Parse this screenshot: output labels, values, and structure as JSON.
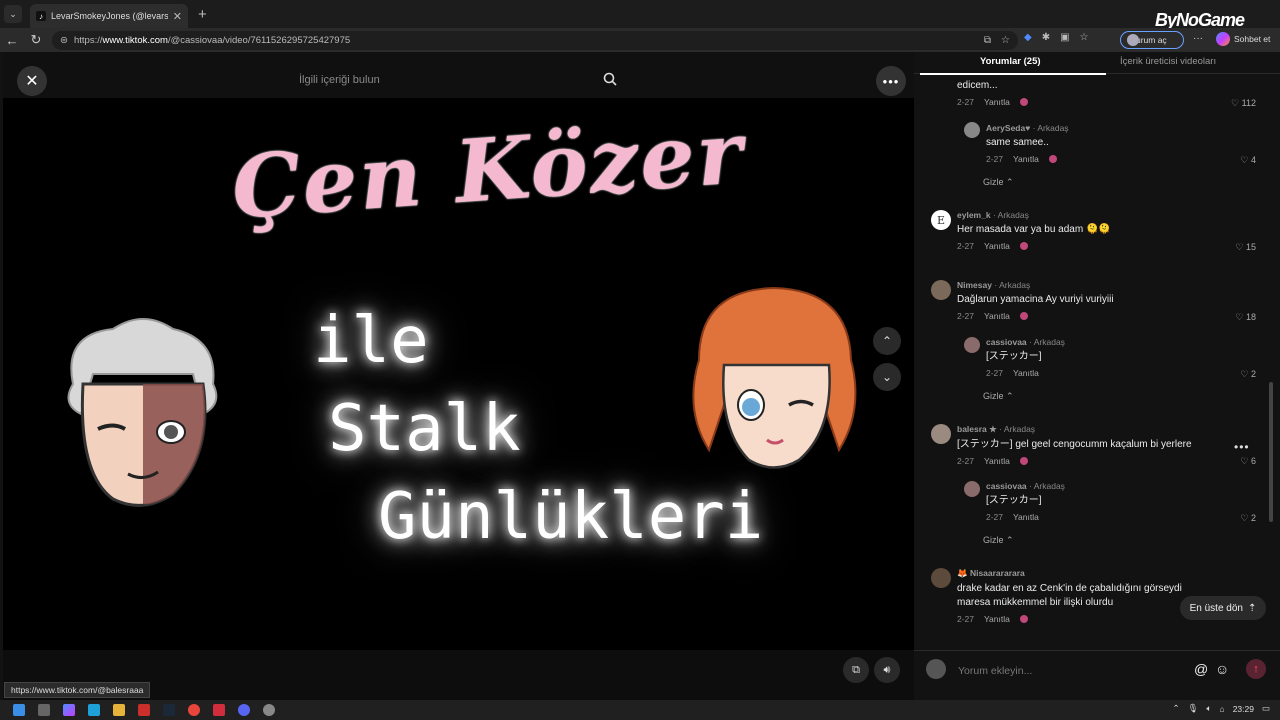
{
  "browser": {
    "tab_title": "LevarSmokeyJones (@levarsmokeyjo",
    "url_prefix": "https://",
    "url_host": "www.tiktok.com",
    "url_path": "/@cassiovaa/video/7611526295725427975",
    "signin_label": "Oturum aç",
    "chat_label": "Sohbet et",
    "watermark": "ByNoGame"
  },
  "video": {
    "search_placeholder": "İlgili içeriği bulun",
    "title_line": "Çen Közer",
    "glow_lines": [
      "ile",
      "Stalk",
      "Günlükleri"
    ]
  },
  "panel": {
    "tab_comments": "Yorumlar (25)",
    "tab_creator": "İçerik üreticisi videoları",
    "back_to_top": "En üste dön",
    "input_placeholder": "Yorum ekleyin...",
    "reply_label": "Yanıtla",
    "hide_label": "Gizle",
    "comments": [
      {
        "text": "edicem...",
        "date": "2-27",
        "likes": "112"
      },
      {
        "user": "AerySeda♥",
        "rel": "· Arkadaş",
        "text": "same samee..",
        "date": "2-27",
        "likes": "4"
      },
      {
        "user": "eylem_k",
        "rel": "· Arkadaş",
        "text": "Her masada var ya bu adam 🫠🫠",
        "date": "2-27",
        "likes": "15"
      },
      {
        "user": "Nimesay",
        "rel": "· Arkadaş",
        "text": "Dağlarun yamacina Ay vuriyi vuriyiii",
        "date": "2-27",
        "likes": "18"
      },
      {
        "user": "cassiovaa",
        "rel": "· Arkadaş",
        "text": "[ステッカー]",
        "date": "2-27",
        "likes": "2"
      },
      {
        "user": "balesra ★",
        "rel": "· Arkadaş",
        "text": "[ステッカー] gel geel cengocumm kaçalum bi yerlere",
        "date": "2-27",
        "likes": "6"
      },
      {
        "user": "cassiovaa",
        "rel": "· Arkadaş",
        "text": "[ステッカー]",
        "date": "2-27",
        "likes": "2"
      },
      {
        "user": "🦊 Nisaarararara",
        "rel": "",
        "text": "drake kadar en az Cenk'in de çabalıdığını görseydi maresa mükkemmel bir ilişki olurdu",
        "date": "2-27",
        "likes": ""
      }
    ]
  },
  "status_url": "https://www.tiktok.com/@balesraaa",
  "taskbar": {
    "time": "23:29"
  }
}
